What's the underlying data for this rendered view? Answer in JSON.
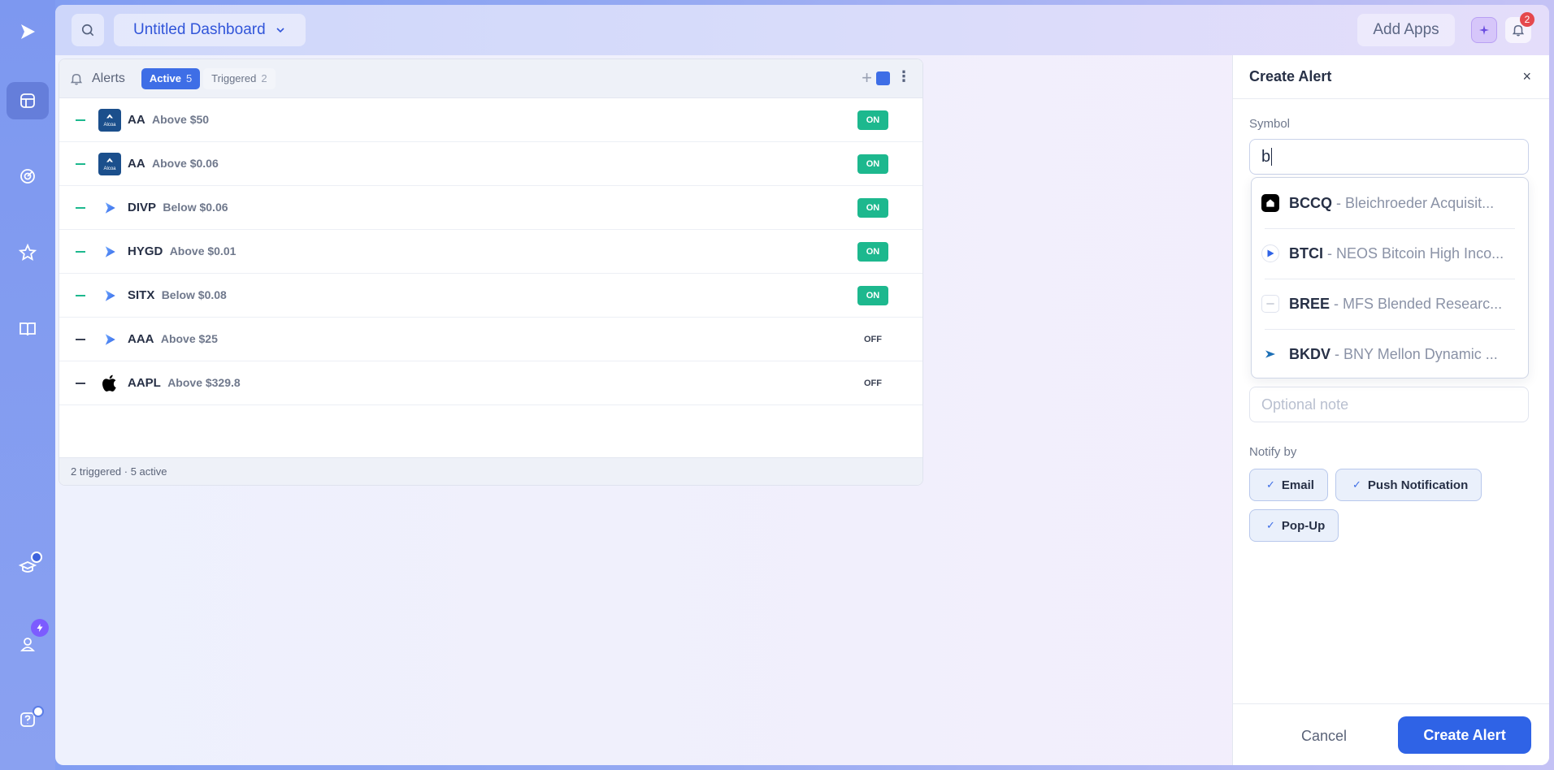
{
  "topbar": {
    "dashboard_title": "Untitled Dashboard",
    "add_apps": "Add Apps",
    "notification_count": "2"
  },
  "alerts_widget": {
    "title": "Alerts",
    "tabs": [
      {
        "label": "Active",
        "count": "5"
      },
      {
        "label": "Triggered",
        "count": "2"
      }
    ],
    "rows": [
      {
        "symbol": "AA",
        "condition": "Above $50",
        "status": "ON",
        "logo": "alcoa"
      },
      {
        "symbol": "AA",
        "condition": "Above $0.06",
        "status": "ON",
        "logo": "alcoa"
      },
      {
        "symbol": "DIVP",
        "condition": "Below $0.06",
        "status": "ON",
        "logo": "play"
      },
      {
        "symbol": "HYGD",
        "condition": "Above $0.01",
        "status": "ON",
        "logo": "play"
      },
      {
        "symbol": "SITX",
        "condition": "Below $0.08",
        "status": "ON",
        "logo": "play"
      },
      {
        "symbol": "AAA",
        "condition": "Above $25",
        "status": "OFF",
        "logo": "play"
      },
      {
        "symbol": "AAPL",
        "condition": "Above $329.8",
        "status": "OFF",
        "logo": "apple"
      }
    ],
    "footer": "2 triggered · 5 active",
    "logo_text": "Alcoa"
  },
  "panel": {
    "title": "Create Alert",
    "close": "×",
    "symbol_label": "Symbol",
    "symbol_value": "b",
    "suggestions": [
      {
        "symbol": "BCCQ",
        "name": " - Bleichroeder Acquisit..."
      },
      {
        "symbol": "BTCI",
        "name": " - NEOS Bitcoin High Inco..."
      },
      {
        "symbol": "BREE",
        "name": " - MFS Blended Researc..."
      },
      {
        "symbol": "BKDV",
        "name": " - BNY Mellon Dynamic ..."
      }
    ],
    "note_placeholder": "Optional note",
    "notify_label": "Notify by",
    "notify_options": [
      "Email",
      "Push Notification",
      "Pop-Up"
    ],
    "cancel": "Cancel",
    "create": "Create Alert"
  },
  "colors": {
    "accent": "#2f63e6",
    "on_green": "#1db88e",
    "badge_red": "#e5484d"
  }
}
